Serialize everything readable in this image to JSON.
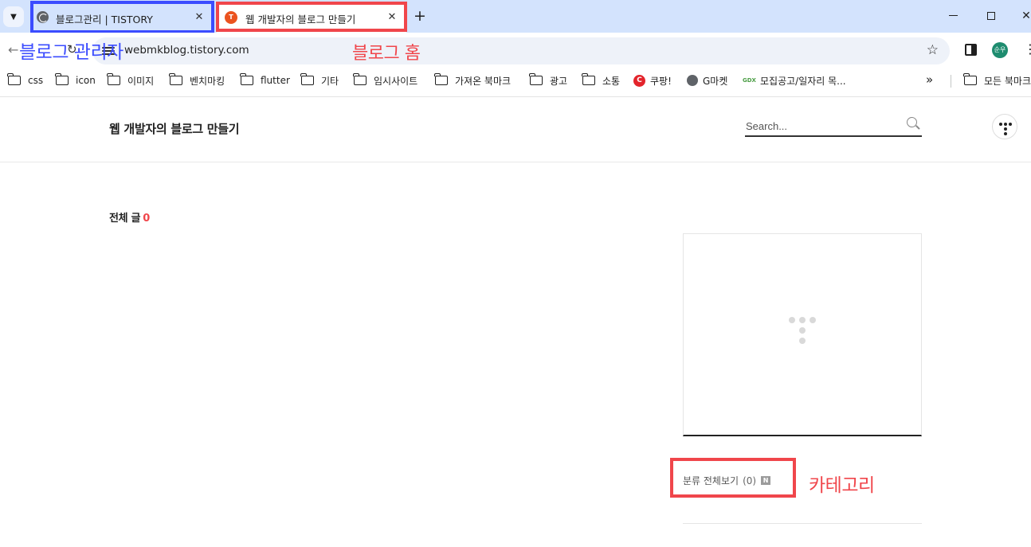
{
  "browser": {
    "tabs": [
      {
        "title": "블로그관리 | TISTORY",
        "active": false
      },
      {
        "title": "웹 개발자의 블로그 만들기",
        "active": true
      }
    ],
    "address": {
      "url": "webmkblog.tistory.com"
    },
    "profile_initials": "순우",
    "bookmarks": [
      {
        "label": "css",
        "icon": "folder-icon"
      },
      {
        "label": "icon",
        "icon": "folder-icon"
      },
      {
        "label": "이미지",
        "icon": "folder-icon"
      },
      {
        "label": "벤치마킹",
        "icon": "folder-icon"
      },
      {
        "label": "flutter",
        "icon": "folder-icon"
      },
      {
        "label": "기타",
        "icon": "folder-icon"
      },
      {
        "label": "임시사이트",
        "icon": "folder-icon"
      },
      {
        "label": "가져온 북마크",
        "icon": "folder-icon"
      },
      {
        "label": "광고",
        "icon": "folder-icon"
      },
      {
        "label": "소통",
        "icon": "folder-icon"
      },
      {
        "label": "쿠팡!",
        "icon": "coupang-icon"
      },
      {
        "label": "G마켓",
        "icon": "globe-icon"
      },
      {
        "label": "모집공고/일자리 목...",
        "icon": "site-icon"
      }
    ],
    "bookmarks_overflow_label": "»",
    "other_bookmarks_label": "모든 북마크"
  },
  "blog": {
    "title": "웹 개발자의 블로그 만들기",
    "search_placeholder": "Search...",
    "post_count_label": "전체 글",
    "post_count": "0",
    "category_label": "분류 전체보기",
    "category_count": "(0)",
    "new_badge": "N"
  },
  "annotations": {
    "admin_label": "블로그 관리자",
    "home_label": "블로그 홈",
    "category_label": "카테고리",
    "colors": {
      "blue": "#3b4cff",
      "red": "#f0464b"
    }
  }
}
